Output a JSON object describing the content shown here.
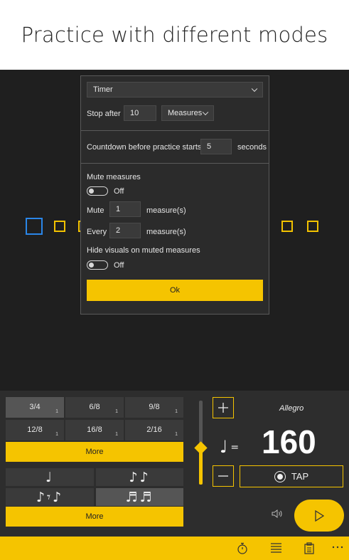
{
  "banner": {
    "title": "Practice with different modes"
  },
  "dialog": {
    "mode_select": "Timer",
    "stop_after_label": "Stop after",
    "stop_after_value": "10",
    "stop_unit_select": "Measures",
    "countdown_label": "Countdown before practice starts",
    "countdown_value": "5",
    "countdown_unit": "seconds",
    "mute_measures_label": "Mute measures",
    "mute_measures_state": "Off",
    "mute_label": "Mute",
    "mute_value": "1",
    "mute_unit": "measure(s)",
    "every_label": "Every",
    "every_value": "2",
    "every_unit": "measure(s)",
    "hide_visuals_label": "Hide visuals on muted measures",
    "hide_visuals_state": "Off",
    "ok_label": "Ok"
  },
  "time_signatures": [
    {
      "value": "3/4",
      "sub": "1",
      "active": true
    },
    {
      "value": "6/8",
      "sub": "1"
    },
    {
      "value": "9/8",
      "sub": "1"
    },
    {
      "value": "12/8",
      "sub": "1"
    },
    {
      "value": "16/8",
      "sub": "1"
    },
    {
      "value": "2/16",
      "sub": "1"
    }
  ],
  "more_label_1": "More",
  "subdivisions": [
    {
      "glyph": "♩"
    },
    {
      "glyph": "♪♪"
    },
    {
      "glyph": "♪𝄾♪"
    },
    {
      "glyph": "♬♬",
      "active": true
    }
  ],
  "more_label_2": "More",
  "tempo": {
    "name": "Allegro",
    "bpm": "160",
    "equals": "=",
    "tap_label": "TAP"
  },
  "colors": {
    "accent": "#f5c400",
    "background": "#1f1f1f",
    "panel": "#2d2d2d",
    "beat_active": "#2a86e8"
  },
  "icons": {
    "plus": "plus-icon",
    "minus": "minus-icon",
    "play": "play-icon",
    "speaker": "speaker-icon",
    "timer": "stopwatch-icon",
    "list": "list-icon",
    "clipboard": "clipboard-icon",
    "more": "more-icon"
  }
}
